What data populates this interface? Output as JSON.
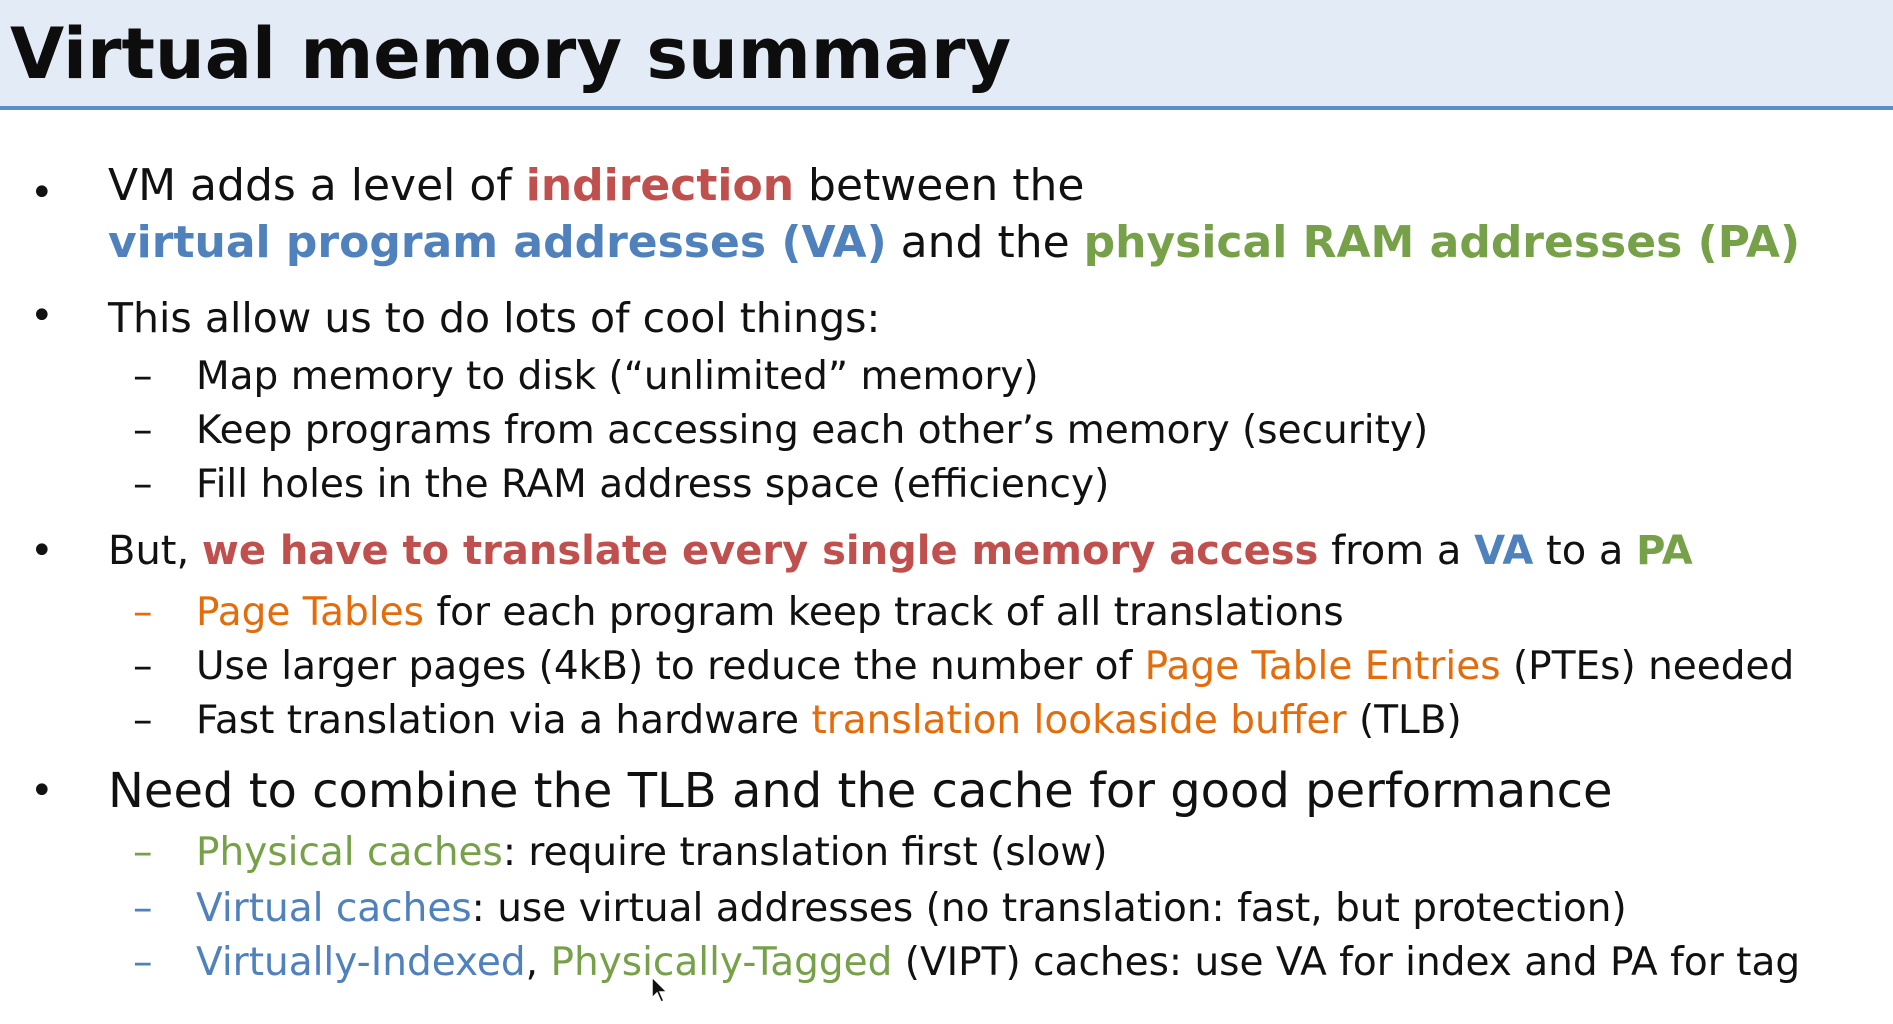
{
  "title": "Virtual memory summary",
  "bullets": {
    "b1": {
      "part1": "VM adds a level of ",
      "emph1": "indirection",
      "part2": " between the",
      "emph2": "virtual program addresses (VA)",
      "part3": " and the ",
      "emph3": "physical RAM addresses (PA)"
    },
    "b2": {
      "text": "This allow us to do lots of cool things:",
      "subs": [
        "Map memory to disk (“unlimited” memory)",
        "Keep programs from accessing each other’s memory (security)",
        "Fill holes in the RAM address space (efficiency)"
      ]
    },
    "b3": {
      "part1": "But, ",
      "emph1": "we have to translate every single memory access",
      "part2": " from a ",
      "emph2": "VA",
      "part3": " to a ",
      "emph3": "PA",
      "sub1": {
        "emph": "Page Tables",
        "rest": " for each program keep track of all translations"
      },
      "sub2": {
        "pre": "Use larger pages (4kB) to reduce the number of ",
        "emph": "Page Table Entries",
        "rest": " (PTEs) needed"
      },
      "sub3": {
        "pre": "Fast translation via a hardware ",
        "emph": "translation lookaside buffer",
        "rest": " (TLB)"
      }
    },
    "b4": {
      "text": "Need to combine the TLB and the cache for good performance",
      "sub1": {
        "emph": "Physical caches",
        "rest": ": require translation first (slow)"
      },
      "sub2": {
        "emph": "Virtual caches",
        "rest": ": use virtual addresses (no translation: fast, but protection)"
      },
      "sub3": {
        "emph1": "Virtually-Indexed",
        "sep": ", ",
        "emph2": "Physically-Tagged",
        "rest": " (VIPT) caches: use VA for index and PA for tag"
      }
    }
  },
  "symbols": {
    "bullet": "•",
    "dash": "–"
  },
  "colors": {
    "title_bg": "#e3ecf6",
    "title_rule": "#5b8fc9",
    "red": "#c0504d",
    "blue": "#4f81bd",
    "green": "#77a149",
    "orange": "#e46c0a"
  },
  "icons": {
    "cursor": "mouse-pointer-icon"
  }
}
